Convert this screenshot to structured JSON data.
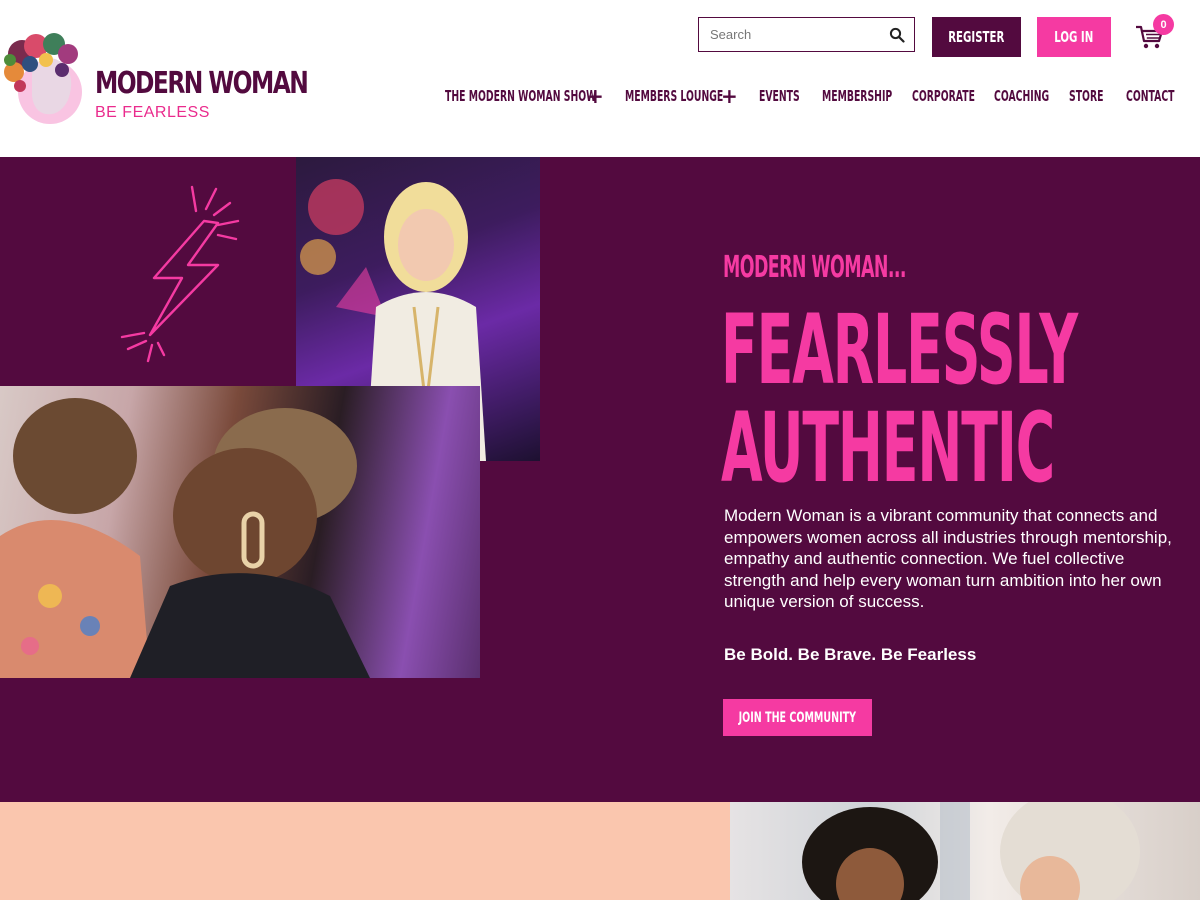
{
  "brand": {
    "name": "MODERN WOMAN",
    "tagline": "BE FEARLESS"
  },
  "header": {
    "search_placeholder": "Search",
    "register_label": "REGISTER",
    "login_label": "LOG IN",
    "cart_count": "0"
  },
  "nav": {
    "items": [
      {
        "label": "THE MODERN WOMAN SHOW",
        "has_submenu": true
      },
      {
        "label": "MEMBERS LOUNGE",
        "has_submenu": true
      },
      {
        "label": "EVENTS",
        "has_submenu": false
      },
      {
        "label": "MEMBERSHIP",
        "has_submenu": false
      },
      {
        "label": "CORPORATE",
        "has_submenu": false
      },
      {
        "label": "COACHING",
        "has_submenu": false
      },
      {
        "label": "STORE",
        "has_submenu": false
      },
      {
        "label": "CONTACT",
        "has_submenu": false
      }
    ],
    "plus_glyph": "+"
  },
  "hero": {
    "eyebrow": "MODERN WOMAN...",
    "headline_line1": "FEARLESSLY",
    "headline_line2": "AUTHENTIC",
    "description": "Modern Woman is a vibrant community that connects and empowers women across all industries through mentorship, empathy and authentic connection. We fuel collective strength and help every woman turn ambition into her own unique version of success.",
    "tagline": "Be Bold. Be Brave. Be Fearless",
    "cta_label": "JOIN THE COMMUNITY"
  },
  "colors": {
    "plum": "#530a3f",
    "pink": "#f53aa2",
    "peach": "#fac6ae",
    "white": "#ffffff"
  },
  "icons": {
    "search": "search-icon",
    "cart": "cart-icon",
    "bolt": "lightning-bolt-icon",
    "plus": "plus-icon"
  }
}
